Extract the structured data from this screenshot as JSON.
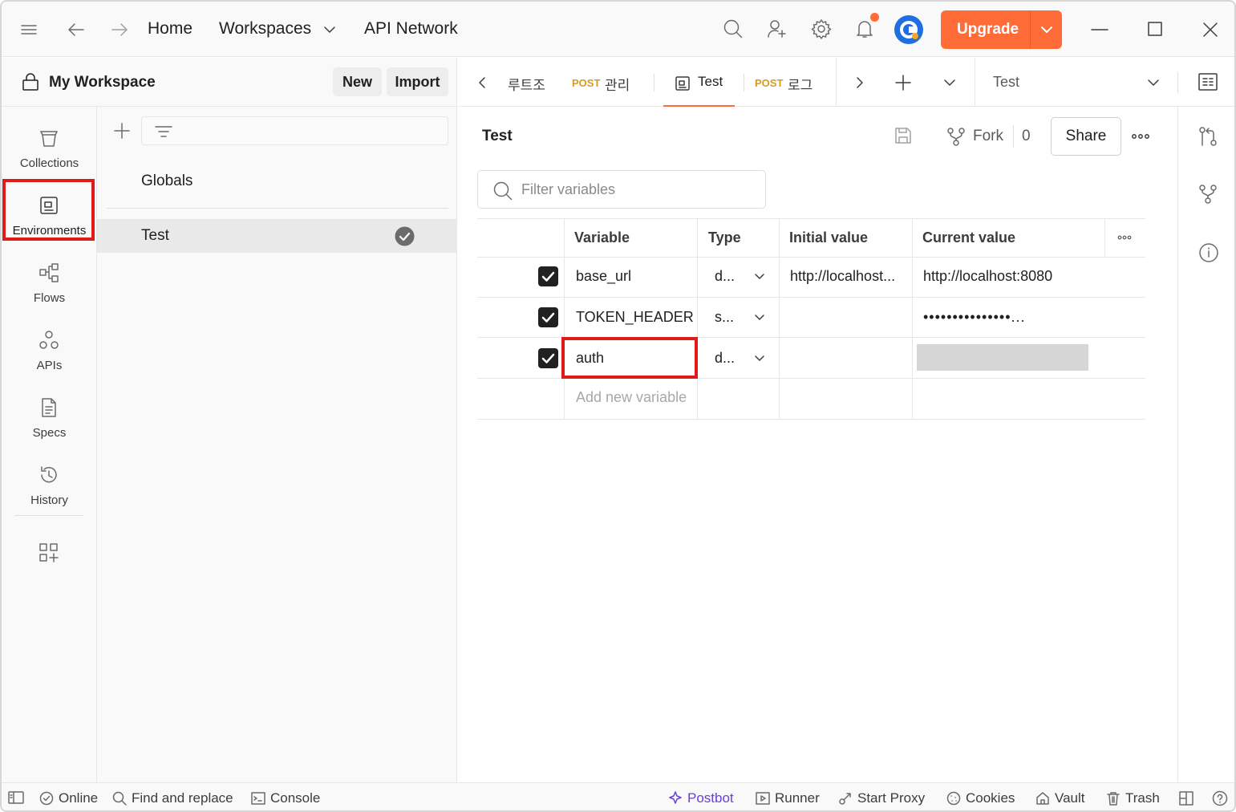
{
  "titlebar": {
    "nav": {
      "home": "Home",
      "workspaces": "Workspaces",
      "api_network": "API Network"
    },
    "upgrade_label": "Upgrade"
  },
  "workspace": {
    "title": "My Workspace",
    "new_label": "New",
    "import_label": "Import"
  },
  "rail": {
    "items": [
      {
        "label": "Collections",
        "icon": "collections-icon"
      },
      {
        "label": "Environments",
        "icon": "environments-icon",
        "selected": true
      },
      {
        "label": "Flows",
        "icon": "flows-icon"
      },
      {
        "label": "APIs",
        "icon": "apis-icon"
      },
      {
        "label": "Specs",
        "icon": "specs-icon"
      },
      {
        "label": "History",
        "icon": "history-icon"
      }
    ]
  },
  "environments": {
    "globals": "Globals",
    "items": [
      {
        "name": "Test",
        "active": true
      }
    ]
  },
  "tabs": [
    {
      "method": "",
      "name": "루트조"
    },
    {
      "method": "POST",
      "name": "관리"
    },
    {
      "method": "",
      "name": "Test",
      "active": true
    },
    {
      "method": "POST",
      "name": "로그"
    }
  ],
  "env_selector": "Test",
  "main": {
    "title": "Test",
    "fork_label": "Fork",
    "fork_count": "0",
    "share_label": "Share",
    "filter_placeholder": "Filter variables",
    "columns": {
      "variable": "Variable",
      "type": "Type",
      "initial": "Initial value",
      "current": "Current value"
    },
    "rows": [
      {
        "checked": true,
        "variable": "base_url",
        "type": "d...",
        "initial": "http://localhost...",
        "current": "http://localhost:8080"
      },
      {
        "checked": true,
        "variable": "TOKEN_HEADER",
        "type": "s...",
        "initial": "",
        "current": "•••••••••••••••..."
      },
      {
        "checked": true,
        "variable": "auth",
        "type": "d...",
        "initial": "",
        "current": ""
      }
    ],
    "add_placeholder": "Add new variable"
  },
  "statusbar": {
    "online": "Online",
    "find_replace": "Find and replace",
    "console": "Console",
    "postbot": "Postbot",
    "runner": "Runner",
    "start_proxy": "Start Proxy",
    "cookies": "Cookies",
    "vault": "Vault",
    "trash": "Trash"
  },
  "colors": {
    "accent": "#ff6c37",
    "highlight": "#e01b1b",
    "postbot": "#6b3fd6",
    "method_post": "#d99a20"
  }
}
